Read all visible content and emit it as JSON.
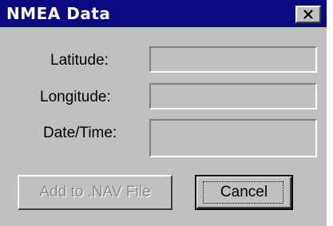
{
  "window": {
    "title": "NMEA Data"
  },
  "fields": {
    "latitude_label": "Latitude:",
    "latitude_value": "",
    "longitude_label": "Longitude:",
    "longitude_value": "",
    "datetime_label": "Date/Time:",
    "datetime_value": ""
  },
  "buttons": {
    "add_label": "Add to .NAV File",
    "cancel_label": "Cancel"
  },
  "icons": {
    "close": "close-icon"
  },
  "colors": {
    "titlebar": "#0a0a80",
    "face": "#c0c0c0",
    "disabled_text": "#8c8c8c"
  }
}
